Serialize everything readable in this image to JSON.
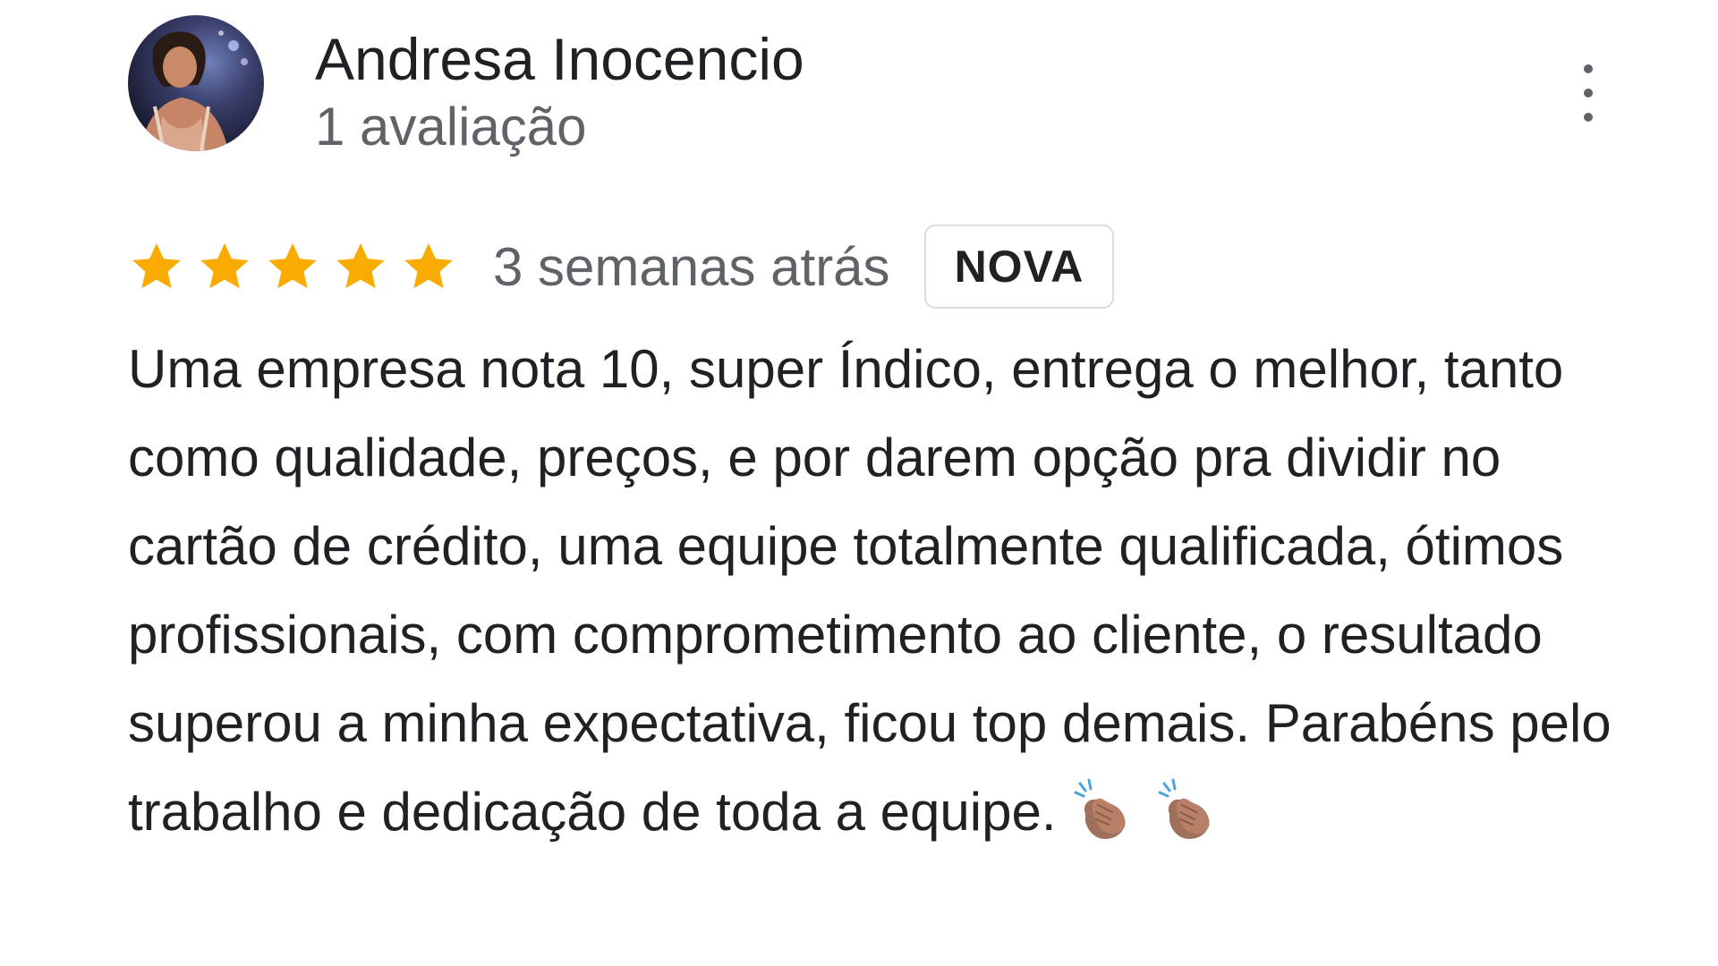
{
  "review": {
    "author": {
      "name": "Andresa Inocencio",
      "review_count": "1 avaliação",
      "avatar_icon": "user-photo"
    },
    "rating": {
      "stars": 5,
      "max_stars": 5,
      "star_color": "#f9ab00"
    },
    "date": "3 semanas atrás",
    "badge": "NOVA",
    "text": "Uma empresa nota 10, super Índico, entrega o melhor, tanto como qualidade, preços, e por darem opção pra dividir no cartão de crédito, uma equipe totalmente qualificada, ótimos profissionais, com comprometimento ao cliente, o resultado superou a minha expectativa, ficou top demais. Parabéns pelo trabalho e dedicação de toda a equipe.",
    "emojis": [
      "clapping-hands",
      "clapping-hands"
    ],
    "menu_icon": "more-vert-icon"
  }
}
